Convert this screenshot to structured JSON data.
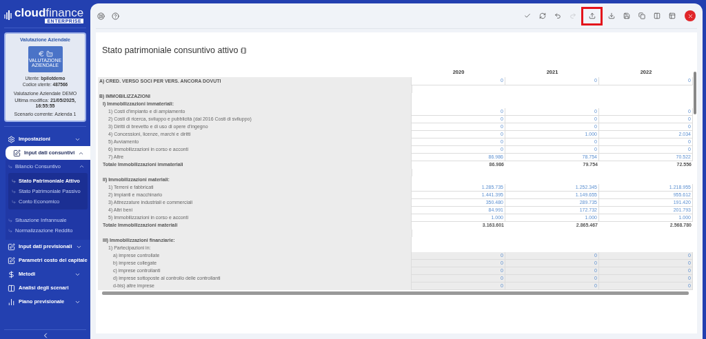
{
  "brand": {
    "name_bold": "cloud",
    "name_light": "finance",
    "edition": "ENTERPRISE"
  },
  "profile": {
    "title": "Valutazione Aziendale",
    "logo_caption": "VALUTAZIONE AZIENDALE",
    "user": "Utente: **bpilotdemo**",
    "code": "Codice utente: **487566**",
    "project": "Valutazione Aziendale DEMO",
    "modified": "Ultima modifica: **21/05/2025, 16:55:55**",
    "scenario": "Scenario corrente: Azienda 1"
  },
  "menu": [
    {
      "kind": "group",
      "label": "Impostazioni",
      "selected": false,
      "expanded": false
    },
    {
      "kind": "group",
      "label": "Input dati consuntivi",
      "selected": true,
      "expanded": true,
      "children": [
        {
          "kind": "group",
          "label": "Bilancio Consuntivo",
          "selected": false,
          "expanded": true,
          "children": [
            {
              "kind": "link",
              "label": "Stato Patrimoniale Attivo",
              "selected": true
            },
            {
              "kind": "link",
              "label": "Stato Patrimoniale Passivo",
              "selected": false
            },
            {
              "kind": "link",
              "label": "Conto Economico",
              "selected": false
            }
          ]
        },
        {
          "kind": "link",
          "label": "Situazione Infrannuale",
          "selected": false
        },
        {
          "kind": "link",
          "label": "Normalizzazione Reddito",
          "selected": false
        }
      ]
    },
    {
      "kind": "group",
      "label": "Input dati previsionali",
      "selected": false,
      "expanded": false
    },
    {
      "kind": "link",
      "label": "Parametri costo del capitale",
      "selected": false
    },
    {
      "kind": "group",
      "label": "Metodi",
      "selected": false,
      "expanded": false
    },
    {
      "kind": "link",
      "label": "Analisi degli scenari",
      "selected": false
    },
    {
      "kind": "group",
      "label": "Piano previsionale",
      "selected": false,
      "expanded": false
    }
  ],
  "toolbar": [
    {
      "disabled": false,
      "highlighted": false
    },
    {
      "disabled": false,
      "highlighted": false
    },
    {
      "disabled": false,
      "highlighted": false
    },
    {
      "disabled": true,
      "highlighted": false
    },
    {
      "disabled": false,
      "highlighted": true
    },
    {
      "disabled": false,
      "highlighted": false
    },
    {
      "disabled": false,
      "highlighted": false
    },
    {
      "disabled": false,
      "highlighted": false
    },
    {
      "disabled": false,
      "highlighted": false
    },
    {
      "disabled": false,
      "highlighted": false
    }
  ],
  "page_title": "Stato patrimoniale consuntivo attivo",
  "table": {
    "columns": [
      "2020",
      "2021",
      "2022"
    ],
    "rows": [
      {
        "kind": "input",
        "label": "A) CRED. VERSO SOCI PER VERS. ANCORA DOVUTI",
        "values": [
          "0",
          "0",
          "0"
        ]
      },
      {
        "kind": "spacer"
      },
      {
        "kind": "heading",
        "label": "B) IMMOBILIZZAZIONI",
        "children": [
          {
            "kind": "heading",
            "label": "I) Immobilizzazioni immateriali:",
            "children": [
              {
                "kind": "input",
                "label": "1) Costi d'impianto e di ampiamento",
                "values": [
                  "0",
                  "0",
                  "0"
                ]
              },
              {
                "kind": "input",
                "label": "2) Costi di ricerca, sviluppo e pubblicità (dal 2016 Costi di sviluppo)",
                "values": [
                  "0",
                  "0",
                  "0"
                ]
              },
              {
                "kind": "input",
                "label": "3) Diritti di brevetto e di uso di opere d'ingegno",
                "values": [
                  "0",
                  "0",
                  "0"
                ]
              },
              {
                "kind": "input",
                "label": "4) Concessioni, licenze, marchi e diritti",
                "values": [
                  "0",
                  "1.000",
                  "2.034"
                ]
              },
              {
                "kind": "input",
                "label": "5) Avviamento",
                "values": [
                  "0",
                  "0",
                  "0"
                ]
              },
              {
                "kind": "input",
                "label": "6) Immobilizzazioni in corso e acconti",
                "values": [
                  "0",
                  "0",
                  "0"
                ]
              },
              {
                "kind": "input",
                "label": "7) Altre",
                "values": [
                  "86.986",
                  "78.754",
                  "70.522"
                ]
              }
            ]
          },
          {
            "kind": "total",
            "label": "Totale Immobilizzazioni immateriali",
            "values": [
              "86.986",
              "79.754",
              "72.556"
            ]
          },
          {
            "kind": "spacer"
          },
          {
            "kind": "heading",
            "label": "II) Immobilizzazioni materiali:",
            "children": [
              {
                "kind": "input",
                "label": "1) Terreni e fabbricati",
                "values": [
                  "1.285.735",
                  "1.252.345",
                  "1.218.955"
                ]
              },
              {
                "kind": "input",
                "label": "2) Impianti e macchinario",
                "values": [
                  "1.441.395",
                  "1.149.655",
                  "955.612"
                ]
              },
              {
                "kind": "input",
                "label": "3) Attrezzature industriali e commerciali",
                "values": [
                  "350.480",
                  "289.735",
                  "191.420"
                ]
              },
              {
                "kind": "input",
                "label": "4) Altri beni",
                "values": [
                  "84.991",
                  "172.732",
                  "201.793"
                ]
              },
              {
                "kind": "input",
                "label": "5) Immobilizzazioni in corso e acconti",
                "values": [
                  "1.000",
                  "1.000",
                  "1.000"
                ]
              }
            ]
          },
          {
            "kind": "total",
            "label": "Totale Immobilizzazioni materiali",
            "values": [
              "3.163.601",
              "2.865.467",
              "2.568.780"
            ]
          },
          {
            "kind": "spacer"
          },
          {
            "kind": "heading",
            "label": "III) Immobilizzazioni finanziarie:",
            "children": [
              {
                "kind": "subheading",
                "label": "1) Partecipazioni in:",
                "children": [
                  {
                    "kind": "locked",
                    "label": "a) imprese controllate",
                    "values": [
                      "0",
                      "0",
                      "0"
                    ]
                  },
                  {
                    "kind": "locked",
                    "label": "b) imprese collegate",
                    "values": [
                      "0",
                      "0",
                      "0"
                    ]
                  },
                  {
                    "kind": "locked",
                    "label": "c) imprese controllanti",
                    "values": [
                      "0",
                      "0",
                      "0"
                    ]
                  },
                  {
                    "kind": "locked",
                    "label": "d) imprese sottoposte al controllo delle controllanti",
                    "values": [
                      "0",
                      "0",
                      "0"
                    ]
                  },
                  {
                    "kind": "locked",
                    "label": "d-bis) altre imprese",
                    "values": [
                      "0",
                      "0",
                      "0"
                    ]
                  }
                ]
              }
            ]
          }
        ]
      }
    ]
  }
}
